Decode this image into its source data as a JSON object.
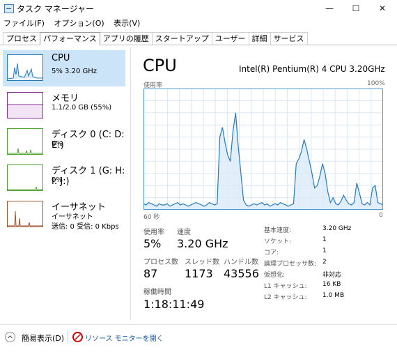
{
  "window": {
    "title": "タスク マネージャー",
    "minimize": "—",
    "maximize": "☐",
    "close": "✕"
  },
  "menu": [
    "ファイル(F)",
    "オプション(O)",
    "表示(V)"
  ],
  "tabs": [
    "プロセス",
    "パフォーマンス",
    "アプリの履歴",
    "スタートアップ",
    "ユーザー",
    "詳細",
    "サービス"
  ],
  "active_tab": "パフォーマンス",
  "sidebar": {
    "items": [
      {
        "title": "CPU",
        "sub": "5% 3.20 GHz",
        "color": "#1f7bc4",
        "active": true
      },
      {
        "title": "メモリ",
        "sub": "1.1/2.0 GB (55%)",
        "color": "#8b2f9c"
      },
      {
        "title": "ディスク 0 (C: D: E:)",
        "sub": "0%",
        "color": "#4ca22e"
      },
      {
        "title": "ディスク 1 (G: H: I: J:)",
        "sub": "0%",
        "color": "#4ca22e"
      },
      {
        "title": "イーサネット",
        "sub": "イーサネット",
        "sub2": "送信: 0 受信: 0 Kbps",
        "color": "#a0522d"
      }
    ]
  },
  "main": {
    "title": "CPU",
    "model": "Intel(R) Pentium(R) 4 CPU 3.20GHz",
    "graph_label": "使用率",
    "graph_max": "100%",
    "time_left": "60 秒",
    "time_right": "0",
    "graph_line_color": "#1f7bc4",
    "graph_fill_color": "#dbeaf7",
    "stats": {
      "usage_label": "使用率",
      "usage_value": "5%",
      "speed_label": "速度",
      "speed_value": "3.20 GHz",
      "process_label": "プロセス数",
      "process_value": "87",
      "thread_label": "スレッド数",
      "thread_value": "1173",
      "handle_label": "ハンドル数",
      "handle_value": "43556",
      "uptime_label": "稼働時間",
      "uptime_value": "1:18:11:49"
    },
    "specs": [
      {
        "label": "基本速度:",
        "value": "3.20 GHz"
      },
      {
        "label": "ソケット:",
        "value": "1"
      },
      {
        "label": "コア:",
        "value": "1"
      },
      {
        "label": "論理プロセッサ数:",
        "value": "2"
      },
      {
        "label": "仮想化:",
        "value": "非対応"
      },
      {
        "label": "L1 キャッシュ:",
        "value": "16 KB"
      },
      {
        "label": "L2 キャッシュ:",
        "value": "1.0 MB"
      }
    ]
  },
  "chart_data": {
    "type": "area",
    "y_range": [
      0,
      100
    ],
    "series": [
      {
        "values": [
          5,
          4,
          6,
          5,
          4,
          3,
          5,
          4,
          4,
          5,
          3,
          4,
          5,
          6,
          4,
          5,
          4,
          3,
          4,
          5,
          6,
          5,
          4,
          3,
          4,
          6,
          5,
          4,
          5,
          60,
          68,
          55,
          45,
          40,
          65,
          80,
          52,
          30,
          8,
          4,
          3,
          4,
          5,
          4,
          5,
          6,
          4,
          5,
          3,
          4,
          5,
          4,
          6,
          5,
          4,
          3,
          4,
          5,
          38,
          42,
          48,
          58,
          50,
          40,
          30,
          18,
          20,
          28,
          38,
          30,
          15,
          6,
          10,
          5,
          4,
          7,
          12,
          8,
          5,
          4,
          6,
          22,
          14,
          5,
          4,
          6,
          4,
          18,
          20,
          6,
          5,
          4
        ]
      }
    ]
  },
  "bottom": {
    "collapse": "簡易表示(D)",
    "resmon": "リソース モニターを開く"
  }
}
